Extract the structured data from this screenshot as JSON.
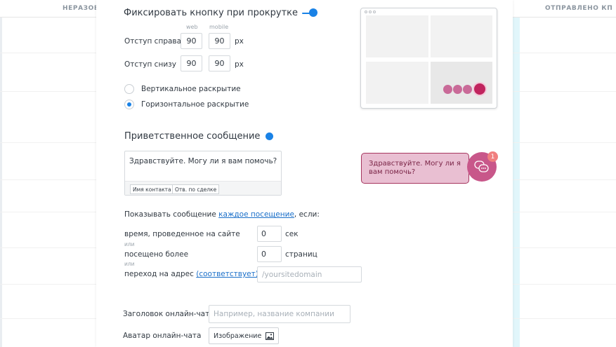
{
  "background": {
    "columns": [
      "НЕРАЗОБ",
      "ОТПРАВЛЕНО КП"
    ]
  },
  "fix_button": {
    "title": "Фиксировать кнопку при прокрутке",
    "col_web": "web",
    "col_mobile": "mobile",
    "right_label": "Отступ справа",
    "right_web": "90",
    "right_mobile": "90",
    "bottom_label": "Отступ снизу",
    "bottom_web": "90",
    "bottom_mobile": "90",
    "unit": "px",
    "radio_vertical": "Вертикальное раскрытие",
    "radio_horizontal": "Горизонтальное раскрытие",
    "selected": "horizontal"
  },
  "greeting": {
    "title": "Приветственное сообщение",
    "text": "Здравствуйте. Могу ли я вам помочь?",
    "tag_contact": "Имя контакта",
    "tag_deal": "Отв. по сделке",
    "bubble_line1": "Здравствуйте. Могу ли я",
    "bubble_line2": "вам помочь?",
    "badge": "1"
  },
  "show_message": {
    "prefix": "Показывать сообщение ",
    "link": "каждое посещение",
    "suffix": ", если:",
    "time_label": "время, проведенное на сайте",
    "time_value": "0",
    "time_unit": "сек",
    "or1": "или",
    "visited_label": "посещено более",
    "visited_value": "0",
    "visited_unit": "страниц",
    "or2": "или",
    "url_label": "переход на адрес",
    "url_link": "(соответствует)",
    "url_placeholder": "/yoursitedomain"
  },
  "chat": {
    "header_label": "Заголовок онлайн-чата",
    "header_placeholder": "Например, название компании",
    "avatar_label": "Аватар онлайн-чата",
    "avatar_button": "Изображение"
  },
  "colors": {
    "accent": "#1a82e6",
    "bubble_bg": "#e9bfd2",
    "bubble_border": "#a6365f",
    "chat_circle": "#c8578a",
    "badge": "#f07f7f"
  }
}
